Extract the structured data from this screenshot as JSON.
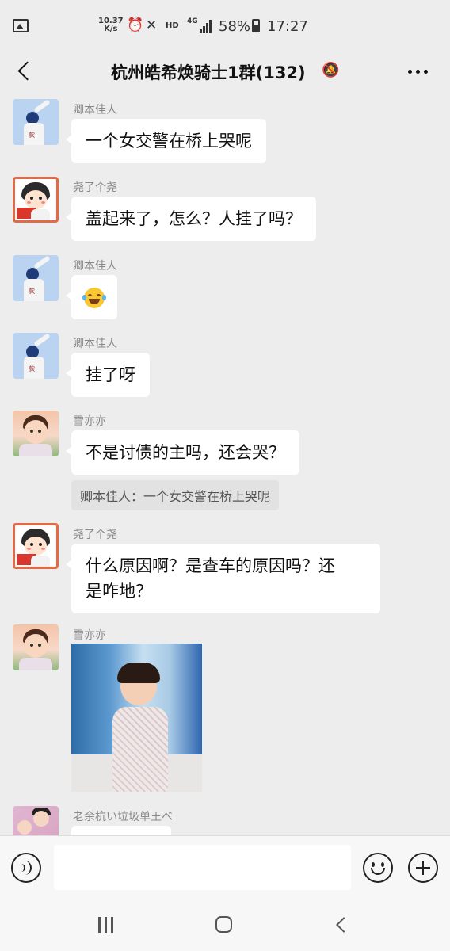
{
  "status_bar": {
    "net_speed_value": "10.37",
    "net_speed_unit": "K/s",
    "hd_label": "HD",
    "network_label": "4G",
    "battery_percent": "58%",
    "battery_level": 0.58,
    "time": "17:27"
  },
  "header": {
    "title": "杭州皓希焕骑士1群(132)",
    "muted": true
  },
  "messages": [
    {
      "sender": "卿本佳人",
      "avatar": "jbjr",
      "text": "一个女交警在桥上哭呢"
    },
    {
      "sender": "尧了个尧",
      "avatar": "yao",
      "text": "盖起来了，怎么？人挂了吗？"
    },
    {
      "sender": "卿本佳人",
      "avatar": "jbjr",
      "emoji": "tears-of-joy"
    },
    {
      "sender": "卿本佳人",
      "avatar": "jbjr",
      "text": "挂了呀"
    },
    {
      "sender": "雪亦亦",
      "avatar": "xue",
      "text": "不是讨债的主吗，还会哭？",
      "quote": "卿本佳人：一个女交警在桥上哭呢"
    },
    {
      "sender": "尧了个尧",
      "avatar": "yao",
      "text_line1": "什么原因啊？是查车的原因吗？还",
      "text_line2": "是咋地？"
    },
    {
      "sender": "雪亦亦",
      "avatar": "xue",
      "image": "photo-of-toddler"
    },
    {
      "sender": "老余杭い垃圾单王べ",
      "avatar": "lao",
      "text": ""
    }
  ],
  "input_bar": {
    "placeholder": "",
    "value": ""
  }
}
